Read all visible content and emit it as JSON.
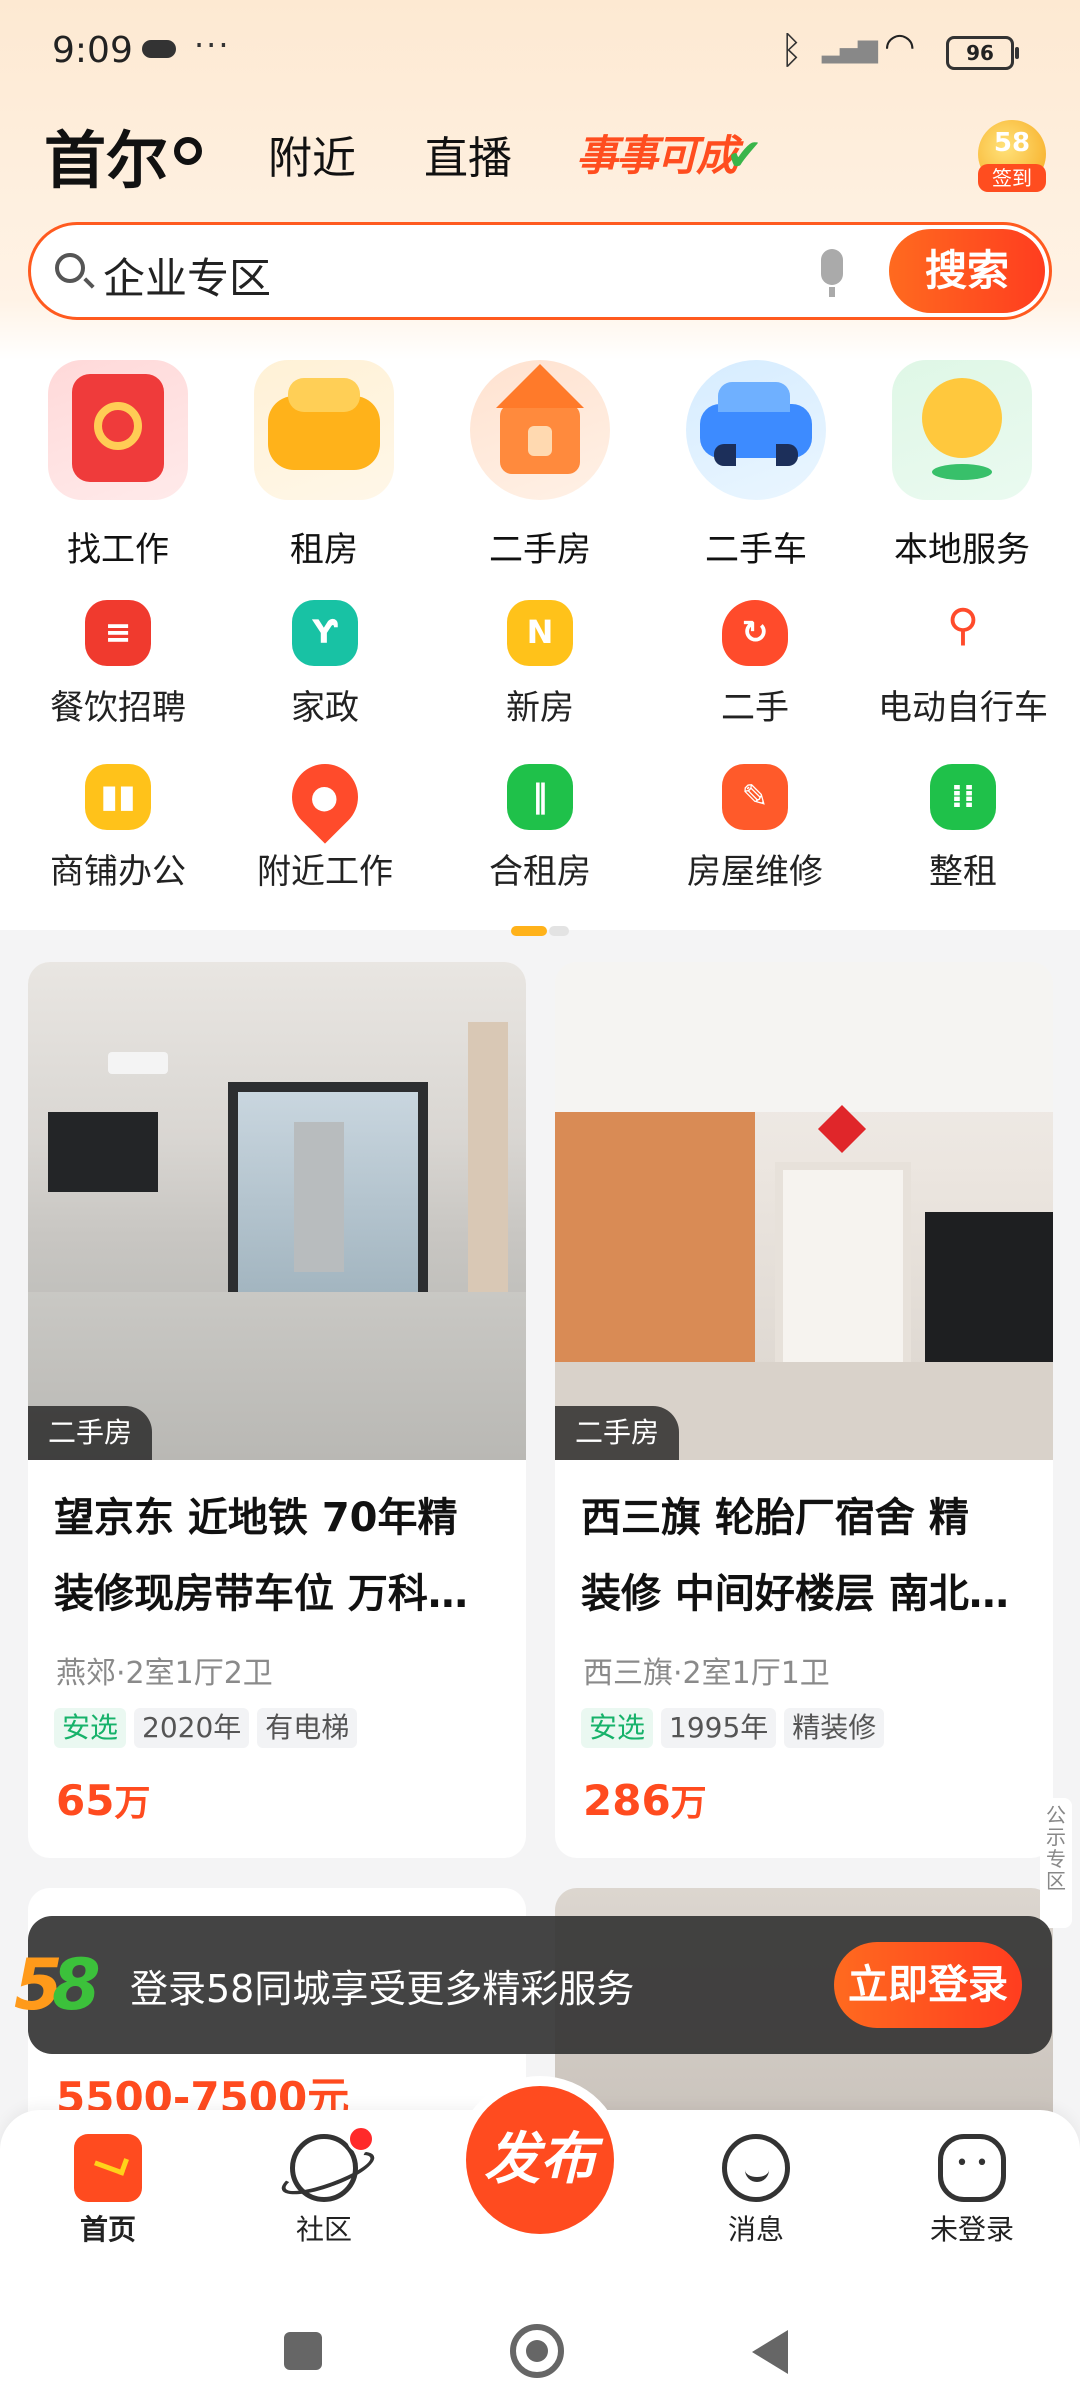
{
  "status_bar": {
    "time": "9:09",
    "battery": "96"
  },
  "top_tabs": {
    "city": "首尔",
    "nearby": "附近",
    "live": "直播",
    "promo": "事事可成"
  },
  "signin": {
    "number": "58",
    "label": "签到"
  },
  "search": {
    "query": "企业专区",
    "button": "搜索"
  },
  "big_categories": [
    {
      "label": "找工作",
      "icon": "briefcase-icon"
    },
    {
      "label": "租房",
      "icon": "sofa-icon"
    },
    {
      "label": "二手房",
      "icon": "house-icon"
    },
    {
      "label": "二手车",
      "icon": "car-icon"
    },
    {
      "label": "本地服务",
      "icon": "location-pin-icon"
    }
  ],
  "small_categories_row1": [
    {
      "label": "餐饮招聘",
      "icon": "chef-hat-icon"
    },
    {
      "label": "家政",
      "icon": "sprout-icon"
    },
    {
      "label": "新房",
      "icon": "new-house-icon"
    },
    {
      "label": "二手",
      "icon": "recycle-icon"
    },
    {
      "label": "电动自行车",
      "icon": "ebike-icon"
    }
  ],
  "small_categories_row2": [
    {
      "label": "商铺办公",
      "icon": "building-icon"
    },
    {
      "label": "附近工作",
      "icon": "map-pin-icon"
    },
    {
      "label": "合租房",
      "icon": "shared-room-icon"
    },
    {
      "label": "房屋维修",
      "icon": "wrench-icon"
    },
    {
      "label": "整租",
      "icon": "grid-icon"
    }
  ],
  "pager": {
    "pages": 2,
    "active": 1
  },
  "listings": [
    {
      "tag": "二手房",
      "title_line1": "望京东 近地铁 70年精",
      "title_line2": "装修现房带车位 万科…",
      "meta": "燕郊·2室1厅2卫",
      "tags": [
        "安选",
        "2020年",
        "有电梯"
      ],
      "price": "65",
      "unit": "万"
    },
    {
      "tag": "二手房",
      "title_line1": "西三旗 轮胎厂宿舍 精",
      "title_line2": "装修 中间好楼层 南北…",
      "meta": "西三旗·2室1厅1卫",
      "tags": [
        "安选",
        "1995年",
        "精装修"
      ],
      "price": "286",
      "unit": "万"
    }
  ],
  "partial_listing": {
    "price": "5500-7500元"
  },
  "notice_tab": "公示专区",
  "login_banner": {
    "text": "登录58同城享受更多精彩服务",
    "button": "立即登录",
    "logo": "58"
  },
  "bottom_nav": [
    {
      "label": "首页",
      "icon": "home-icon"
    },
    {
      "label": "社区",
      "icon": "planet-icon"
    },
    {
      "label": "发布",
      "icon": "publish-icon"
    },
    {
      "label": "消息",
      "icon": "message-icon"
    },
    {
      "label": "未登录",
      "icon": "profile-icon"
    }
  ],
  "colors": {
    "accent": "#ff4b1f",
    "price": "#ff4b1f",
    "brand_green": "#3cc13b"
  }
}
